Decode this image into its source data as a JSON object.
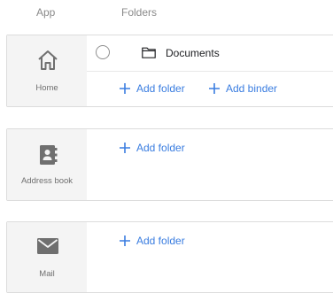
{
  "headers": {
    "app": "App",
    "folders": "Folders"
  },
  "apps": [
    {
      "label": "Home",
      "icon": "home-icon",
      "folders": [
        {
          "name": "Documents",
          "icon": "folder-icon"
        }
      ],
      "actions": {
        "add_folder": "Add folder",
        "add_binder": "Add binder"
      }
    },
    {
      "label": "Address book",
      "icon": "address-book-icon",
      "actions": {
        "add_folder": "Add folder"
      }
    },
    {
      "label": "Mail",
      "icon": "mail-icon",
      "actions": {
        "add_folder": "Add folder"
      }
    }
  ],
  "colors": {
    "accent": "#3a7de0",
    "app_bg": "#f4f4f4",
    "border": "#dcdcdc"
  }
}
